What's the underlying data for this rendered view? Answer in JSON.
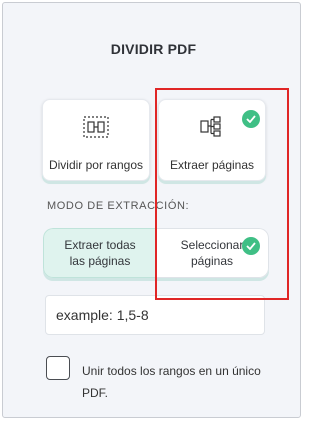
{
  "title": "DIVIDIR PDF",
  "modes": [
    {
      "label": "Dividir por rangos",
      "icon": "split-ranges-icon",
      "selected": false
    },
    {
      "label": "Extraer páginas",
      "icon": "extract-pages-icon",
      "selected": true
    }
  ],
  "extraction": {
    "section_label": "MODO DE EXTRACCIÓN:",
    "option_all": "Extraer todas las páginas",
    "option_select": "Seleccionar páginas",
    "selected": "select"
  },
  "pages_input": {
    "placeholder": "example: 1,5-8",
    "value": ""
  },
  "merge_checkbox": {
    "label": "Unir todos los rangos en un único PDF.",
    "checked": false
  },
  "colors": {
    "accent": "#3fbf85",
    "highlight": "#e02626",
    "selected_bg": "#dff3ee"
  }
}
